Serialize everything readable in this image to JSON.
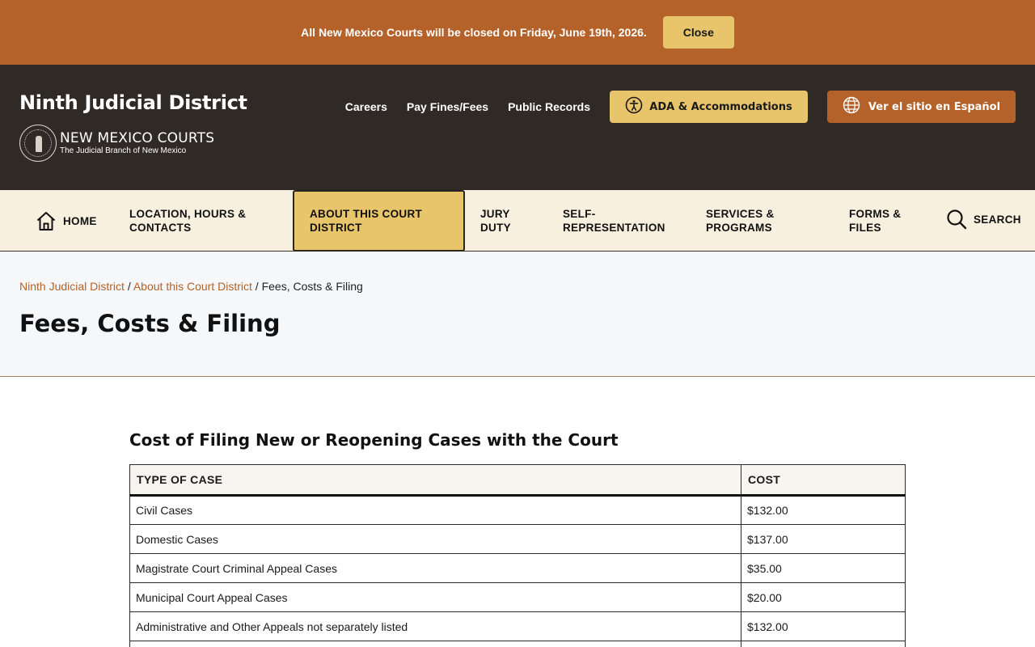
{
  "alert": {
    "message": "All New Mexico Courts will be closed on Friday, June 19th, 2026.",
    "close_label": "Close"
  },
  "header": {
    "site_title": "Ninth Judicial District",
    "logo_name": "NEW MEXICO COURTS",
    "logo_sub": "The Judicial Branch of New Mexico",
    "utility_links": [
      "Careers",
      "Pay Fines/Fees",
      "Public Records"
    ],
    "ada_label": "ADA & Accommodations",
    "spanish_label": "Ver el sitio en Español"
  },
  "nav": {
    "home": "HOME",
    "location": "LOCATION, HOURS & CONTACTS",
    "about": "ABOUT THIS COURT DISTRICT",
    "jury": "JURY DUTY",
    "self_rep": "SELF-REPRESENTATION",
    "services": "SERVICES & PROGRAMS",
    "forms": "FORMS & FILES",
    "search": "SEARCH"
  },
  "breadcrumb": {
    "home": "Ninth Judicial District",
    "parent": "About this Court District",
    "current": "Fees, Costs & Filing",
    "separator": " / "
  },
  "page_title": "Fees, Costs & Filing",
  "section": {
    "title": "Cost of Filing New or Reopening Cases with the Court",
    "table": {
      "headers": [
        "TYPE OF CASE",
        "COST"
      ],
      "rows": [
        [
          "Civil Cases",
          "$132.00"
        ],
        [
          "Domestic Cases",
          "$137.00"
        ],
        [
          "Magistrate Court Criminal Appeal Cases",
          "$35.00"
        ],
        [
          "Municipal Court Appeal Cases",
          "$20.00"
        ],
        [
          "Administrative and Other Appeals not separately listed",
          "$132.00"
        ]
      ]
    }
  },
  "colors": {
    "accent_orange": "#b5612a",
    "accent_gold": "#e8c46a",
    "header_dark": "#302a27",
    "nav_bg": "#f7f0de"
  }
}
